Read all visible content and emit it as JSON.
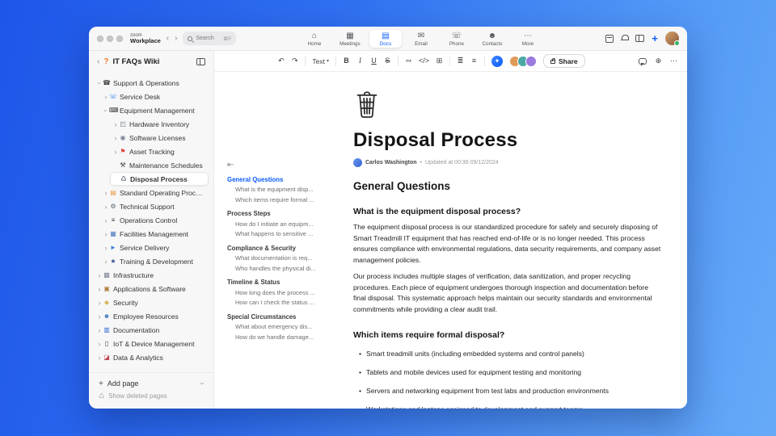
{
  "titlebar": {
    "brand_top": "zoom",
    "brand_bottom": "Workplace",
    "back": "‹",
    "forward": "›",
    "search": {
      "label": "Search",
      "shortcut": "⌘F"
    },
    "plus": "+",
    "tabs": [
      {
        "label": "Home",
        "icon": "⌂",
        "cls": "",
        "name": "tab-home",
        "icon_name": "home-icon"
      },
      {
        "label": "Meetings",
        "icon": "▦",
        "cls": "",
        "name": "tab-meetings",
        "icon_name": "calendar-icon"
      },
      {
        "label": "Docs",
        "icon": "▤",
        "cls": "active",
        "name": "tab-docs",
        "icon_name": "document-icon"
      },
      {
        "label": "Email",
        "icon": "✉",
        "cls": "",
        "name": "tab-email",
        "icon_name": "mail-icon"
      },
      {
        "label": "Phone",
        "icon": "☏",
        "cls": "",
        "name": "tab-phone",
        "icon_name": "phone-icon"
      },
      {
        "label": "Contacts",
        "icon": "☻",
        "cls": "",
        "name": "tab-contacts",
        "icon_name": "contacts-icon"
      },
      {
        "label": "More",
        "icon": "⋯",
        "cls": "",
        "name": "tab-more",
        "icon_name": "more-icon"
      }
    ]
  },
  "sidebar": {
    "back": "‹",
    "logo": "?",
    "title": "IT FAQs Wiki",
    "tree": [
      {
        "label": "Support & Operations",
        "cls": "d0 chev-down",
        "icon": "☎",
        "icon_color": "#3a3a3e",
        "icon_name": "phone-icon"
      },
      {
        "label": "Service Desk",
        "cls": "d1 chev-right",
        "icon": "☏",
        "icon_color": "#2a7de1",
        "icon_name": "headset-icon"
      },
      {
        "label": "Equipment Management",
        "cls": "d1 chev-down",
        "icon": "⌨",
        "icon_color": "#3a3a3e",
        "icon_name": "computer-icon"
      },
      {
        "label": "Hardware Inventory",
        "cls": "d2 chev-right",
        "icon": "◰",
        "icon_color": "#5b6770",
        "icon_name": "controller-icon"
      },
      {
        "label": "Software Licenses",
        "cls": "d2 chev-right",
        "icon": "◉",
        "icon_color": "#7b8494",
        "icon_name": "disc-icon"
      },
      {
        "label": "Asset Tracking",
        "cls": "d2 chev-right",
        "icon": "⚑",
        "icon_color": "#e0443e",
        "icon_name": "pin-icon"
      },
      {
        "label": "Maintenance Schedules",
        "cls": "d2",
        "icon": "⚒",
        "icon_color": "#3a3a3e",
        "icon_name": "tools-icon"
      },
      {
        "label": "Disposal Process",
        "cls": "d2 selected",
        "icon": "♺",
        "icon_color": "#6b7280",
        "icon_name": "trash-icon"
      },
      {
        "label": "Standard Operating Procedures",
        "cls": "d1 chev-right",
        "icon": "▤",
        "icon_color": "#e8943a",
        "icon_name": "book-icon"
      },
      {
        "label": "Technical Support",
        "cls": "d1 chev-right",
        "icon": "⚙",
        "icon_color": "#5b6770",
        "icon_name": "gear-icon"
      },
      {
        "label": "Operations Control",
        "cls": "d1 chev-right",
        "icon": "≡",
        "icon_color": "#3a3a3e",
        "icon_name": "sliders-icon"
      },
      {
        "label": "Facilities Management",
        "cls": "d1 chev-right",
        "icon": "▦",
        "icon_color": "#4a7dbd",
        "icon_name": "building-icon"
      },
      {
        "label": "Service Delivery",
        "cls": "d1 chev-right",
        "icon": "►",
        "icon_color": "#3b7dd8",
        "icon_name": "truck-icon"
      },
      {
        "label": "Training & Development",
        "cls": "d1 chev-right",
        "icon": "★",
        "icon_color": "#34508c",
        "icon_name": "graduation-icon"
      },
      {
        "label": "Infrastructure",
        "cls": "d0 chev-right",
        "icon": "▩",
        "icon_color": "#7b8494",
        "icon_name": "infrastructure-icon"
      },
      {
        "label": "Applications & Software",
        "cls": "d0 chev-right",
        "icon": "▣",
        "icon_color": "#b07d3f",
        "icon_name": "package-icon"
      },
      {
        "label": "Security",
        "cls": "d0 chev-right",
        "icon": "◈",
        "icon_color": "#c9a227",
        "icon_name": "lock-icon"
      },
      {
        "label": "Employee Resources",
        "cls": "d0 chev-right",
        "icon": "☻",
        "icon_color": "#4a7dbd",
        "icon_name": "people-icon"
      },
      {
        "label": "Documentation",
        "cls": "d0 chev-right",
        "icon": "▥",
        "icon_color": "#2e6bd1",
        "icon_name": "books-icon"
      },
      {
        "label": "IoT & Device Management",
        "cls": "d0 chev-right",
        "icon": "▯",
        "icon_color": "#3a3a3e",
        "icon_name": "device-icon"
      },
      {
        "label": "Data & Analytics",
        "cls": "d0 chev-right",
        "icon": "◪",
        "icon_color": "#c14953",
        "icon_name": "chart-icon"
      }
    ],
    "footer": {
      "add_icon": "+",
      "add_page": "Add page",
      "deleted_icon": "♺",
      "show_deleted": "Show deleted pages"
    }
  },
  "editor_toolbar": {
    "undo": "↶",
    "redo": "↷",
    "text_style": "Text",
    "caret": "▾",
    "bold": "B",
    "italic": "I",
    "underline": "U",
    "strike": "S",
    "link": "∾",
    "code": "</>",
    "table": "⊞",
    "bullet_list": "≣",
    "align": "≡",
    "ai": "✦",
    "avatars": [
      {
        "color": "#e09a5a"
      },
      {
        "color": "#4aa9a2"
      },
      {
        "color": "#9a7ae0"
      }
    ],
    "share": "Share",
    "globe": "⊕",
    "more": "⋯"
  },
  "toc": {
    "collapse": "⇤",
    "items": [
      {
        "label": "General Questions",
        "cls": "sec active"
      },
      {
        "label": "What is the equipment disp...",
        "cls": "item"
      },
      {
        "label": "Which items require formal ...",
        "cls": "item"
      },
      {
        "label": "Process Steps",
        "cls": "sec"
      },
      {
        "label": "How do I initiate an equipm...",
        "cls": "item"
      },
      {
        "label": "What happens to sensitive ...",
        "cls": "item"
      },
      {
        "label": "Compliance & Security",
        "cls": "sec"
      },
      {
        "label": "What documentation is req...",
        "cls": "item"
      },
      {
        "label": "Who handles the physical di...",
        "cls": "item"
      },
      {
        "label": "Timeline & Status",
        "cls": "sec"
      },
      {
        "label": "How long does the process ...",
        "cls": "item"
      },
      {
        "label": "How can I check the status ...",
        "cls": "item"
      },
      {
        "label": "Special Circumstances",
        "cls": "sec"
      },
      {
        "label": "What about emergency dis...",
        "cls": "item"
      },
      {
        "label": "How do we handle damage...",
        "cls": "item"
      }
    ]
  },
  "document": {
    "title": "Disposal Process",
    "author": "Carlos Washington",
    "separator": "•",
    "updated": "Updated at 00:39 09/12/2024",
    "blocks": [
      {
        "cls": "h2",
        "text": "General Questions"
      },
      {
        "cls": "h3",
        "text": "What is the equipment disposal process?"
      },
      {
        "cls": "p",
        "text": "The equipment disposal process is our standardized procedure for safely and securely disposing of Smart Treadmill IT equipment that has reached end-of-life or is no longer needed. This process ensures compliance with environmental regulations, data security requirements, and company asset management policies."
      },
      {
        "cls": "p",
        "text": "Our process includes multiple stages of verification, data sanitization, and proper recycling procedures. Each piece of equipment undergoes thorough inspection and documentation before final disposal. This systematic approach helps maintain our security standards and environmental commitments while providing a clear audit trail."
      },
      {
        "cls": "h3",
        "text": "Which items require formal disposal?"
      },
      {
        "cls": "li",
        "text": "Smart treadmill units (including embedded systems and control panels)"
      },
      {
        "cls": "li",
        "text": "Tablets and mobile devices used for equipment testing and monitoring"
      },
      {
        "cls": "li",
        "text": "Servers and networking equipment from test labs and production environments"
      },
      {
        "cls": "li",
        "text": "Workstations and laptops assigned to development and support teams"
      }
    ]
  }
}
